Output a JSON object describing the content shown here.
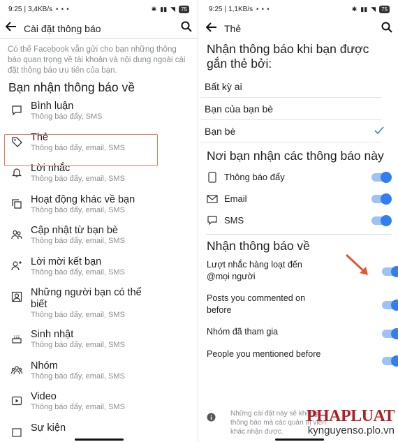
{
  "left": {
    "status": {
      "time": "9:25",
      "speed": "3,4KB/s",
      "dots": "• • •",
      "battery": "75"
    },
    "header": {
      "title": "Cài đặt thông báo"
    },
    "description": "Có thể Facebook vẫn gửi cho bạn những thông báo quan trọng về tài khoản và nội dung ngoài cài đặt thông báo ưu tiên của bạn.",
    "section_title": "Bạn nhận thông báo về",
    "items": [
      {
        "label": "Bình luận",
        "sub": "Thông báo đẩy, SMS",
        "icon": "comment-icon"
      },
      {
        "label": "Thẻ",
        "sub": "Thông báo đẩy, email, SMS",
        "icon": "tag-icon"
      },
      {
        "label": "Lời nhắc",
        "sub": "Thông báo đẩy, email, SMS",
        "icon": "bell-icon"
      },
      {
        "label": "Hoạt động khác về bạn",
        "sub": "Thông báo đẩy, email, SMS",
        "icon": "copy-icon"
      },
      {
        "label": "Cập nhật từ bạn bè",
        "sub": "Thông báo đẩy, email, SMS",
        "icon": "friends-icon"
      },
      {
        "label": "Lời mời kết bạn",
        "sub": "Thông báo đẩy, email, SMS",
        "icon": "add-friend-icon"
      },
      {
        "label": "Những người bạn có thể biết",
        "sub": "Thông báo đẩy, email, SMS",
        "icon": "contact-icon"
      },
      {
        "label": "Sinh nhật",
        "sub": "Thông báo đẩy, email, SMS",
        "icon": "cake-icon"
      },
      {
        "label": "Nhóm",
        "sub": "Thông báo đẩy, email, SMS",
        "icon": "group-icon"
      },
      {
        "label": "Video",
        "sub": "Thông báo đẩy, email, SMS",
        "icon": "video-icon"
      },
      {
        "label": "Sự kiện",
        "sub": "",
        "icon": "calendar-icon"
      }
    ]
  },
  "right": {
    "status": {
      "time": "9:25",
      "speed": "1,1KB/s",
      "dots": "• • •",
      "battery": "75"
    },
    "header": {
      "title": "Thẻ"
    },
    "heading1": "Nhận thông báo khi bạn được gắn thẻ bởi:",
    "options": [
      {
        "label": "Bất kỳ ai",
        "selected": false
      },
      {
        "label": "Bạn của bạn bè",
        "selected": false
      },
      {
        "label": "Bạn bè",
        "selected": true
      }
    ],
    "heading2": "Nơi bạn nhận các thông báo này",
    "channels": [
      {
        "label": "Thông báo đẩy",
        "icon": "phone-icon",
        "on": true
      },
      {
        "label": "Email",
        "icon": "email-icon",
        "on": true
      },
      {
        "label": "SMS",
        "icon": "sms-icon",
        "on": true
      }
    ],
    "heading3": "Nhận thông báo về",
    "notify": [
      {
        "label": "Lượt nhắc hàng loạt đến @mọi người",
        "on": true
      },
      {
        "label": "Posts you commented on before",
        "on": true
      },
      {
        "label": "Nhóm đã tham gia",
        "on": true
      },
      {
        "label": "People you mentioned before",
        "on": true
      }
    ],
    "footer": "Những cài đặt này sẽ không ... thông báo mà các quản trị viên khác nhận được.",
    "accent": "#2f7ff0"
  },
  "watermark": {
    "logo": "PHAPLUAT",
    "url": "kynguyenso.plo.vn"
  }
}
